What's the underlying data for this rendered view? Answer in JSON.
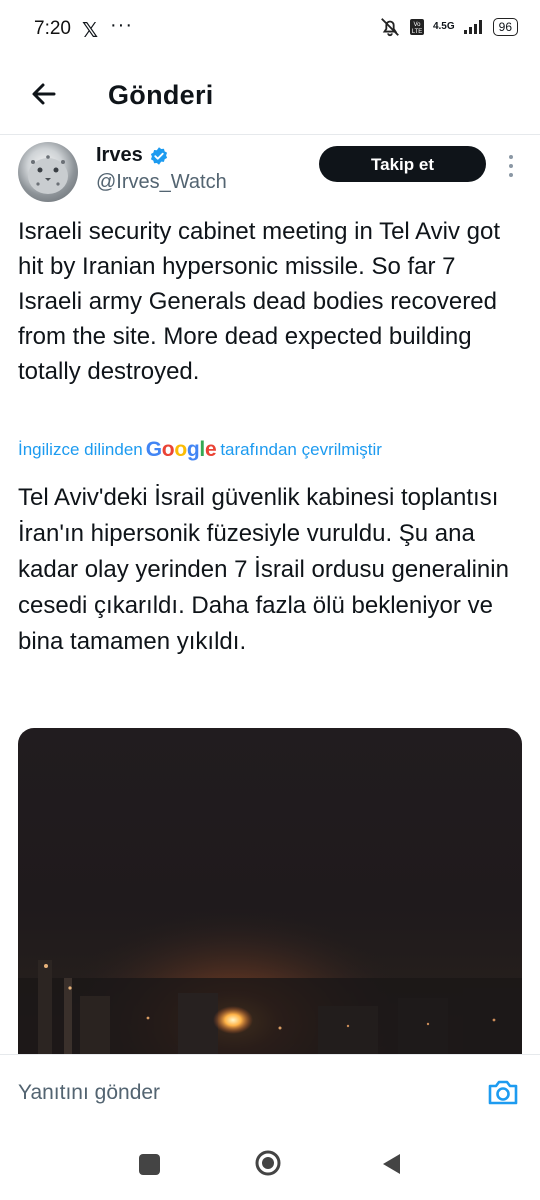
{
  "status_bar": {
    "time": "7:20",
    "app_icon": "x-logo-icon",
    "more_notifications": "···",
    "network": "4.5G",
    "battery": "96"
  },
  "header": {
    "title": "Gönderi"
  },
  "post": {
    "author_name": "Irves",
    "verified": true,
    "author_handle": "@Irves_Watch",
    "follow_label": "Takip et",
    "text": "Israeli security cabinet meeting in Tel Aviv got hit by Iranian hypersonic missile. So far 7 Israeli army Generals dead bodies recovered from the site. More dead expected building totally destroyed.",
    "translation_prefix": "İngilizce dilinden",
    "translation_brand": "Google",
    "translation_suffix": "tarafından çevrilmiştir",
    "translated_text": "Tel Aviv'deki İsrail güvenlik kabinesi toplantısı İran'ın hipersonik füzesiyle vuruldu. Şu ana kadar olay yerinden 7 İsrail ordusu generalinin cesedi çıkarıldı. Daha fazla ölü bekleniyor ve bina tamamen yıkıldı."
  },
  "reply": {
    "placeholder": "Yanıtını gönder"
  },
  "colors": {
    "accent": "#1d9bf0",
    "text": "#0f1419",
    "secondary": "#536471"
  }
}
